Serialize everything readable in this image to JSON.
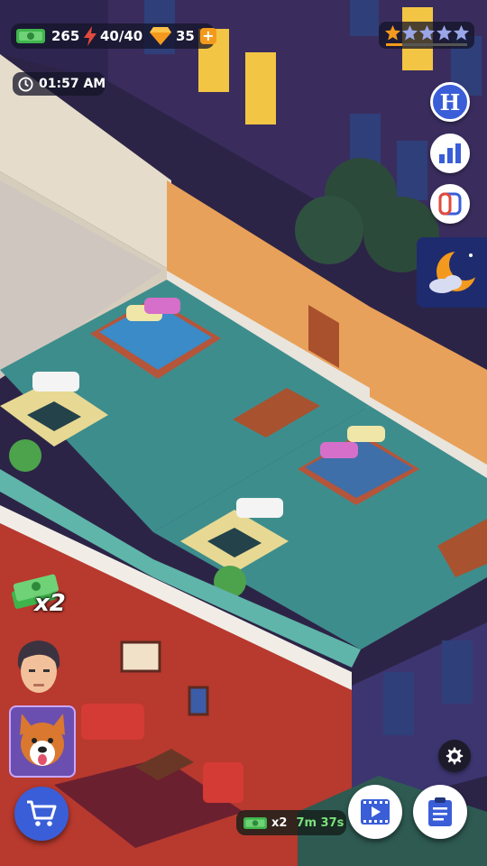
{
  "hud": {
    "money": "265",
    "energy": "40/40",
    "gems": "35",
    "gems_add_symbol": "+",
    "clock": "01:57 AM",
    "stars_filled": 1,
    "stars_total": 5
  },
  "side_buttons": {
    "hotel_letter": "H"
  },
  "bonus": {
    "multiplier_badge": "x2"
  },
  "timer_bar": {
    "multiplier": "x2",
    "time_left": "7m 37s"
  },
  "colors": {
    "accent_blue": "#3a5ed8",
    "gem_orange": "#f39a1e",
    "money_green": "#3fb44c",
    "energy_red": "#e24a3b"
  }
}
